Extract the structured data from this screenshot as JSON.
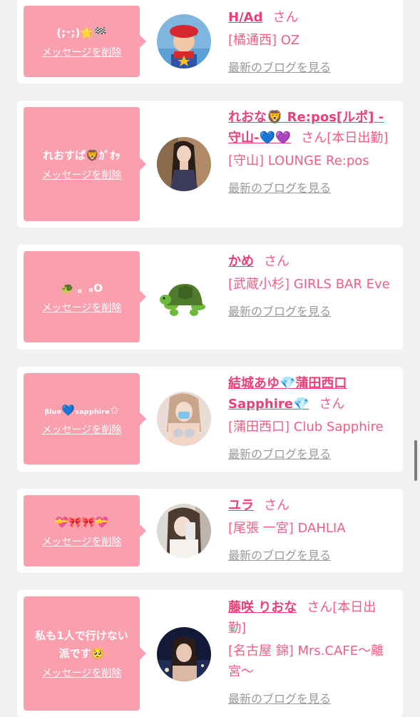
{
  "items": [
    {
      "message": "(;ᵕ;)🌟🏁",
      "delete_label": "メッセージを削除",
      "name": "H/Ad",
      "suffix": "さん",
      "shop": "[橘通西] OZ",
      "blog_label": "最新のブログを見る",
      "avatar": "photo"
    },
    {
      "message": "れおすぱ🦁ｶﾞｵｯ",
      "delete_label": "メッセージを削除",
      "name": "れおな🦁 Re:pos[ルポ] -守山-💙💜",
      "suffix": "さん[本日出勤]",
      "shop": "[守山] LOUNGE Re:pos",
      "blog_label": "最新のブログを見る",
      "avatar": "photo"
    },
    {
      "message": "🐢 。ₒO",
      "delete_label": "メッセージを削除",
      "name": "かめ",
      "suffix": "さん",
      "shop": "[武蔵小杉] GIRLS BAR Eve",
      "blog_label": "最新のブログを見る",
      "avatar": "turtle"
    },
    {
      "message": "ᵦₗᵤₑ💙ₛₐₚₚₕᵢᵣₑ✩",
      "delete_label": "メッセージを削除",
      "name": "結城あゆ💎蒲田西口Sapphire💎",
      "suffix": "さん",
      "shop": "[蒲田西口] Club Sapphire",
      "blog_label": "最新のブログを見る",
      "avatar": "photo"
    },
    {
      "message": "💝🎀🎀💝",
      "delete_label": "メッセージを削除",
      "name": "ユラ",
      "suffix": "さん",
      "shop": "[尾張 一宮] DAHLIA",
      "blog_label": "最新のブログを見る",
      "avatar": "photo"
    },
    {
      "message": "私も1人で行けない派です🥺",
      "delete_label": "メッセージを削除",
      "name": "藤咲 りおな",
      "suffix": "さん[本日出勤]",
      "shop": "[名古屋 錦] Mrs.CAFE〜離宮〜",
      "blog_label": "最新のブログを見る",
      "avatar": "photo"
    }
  ]
}
